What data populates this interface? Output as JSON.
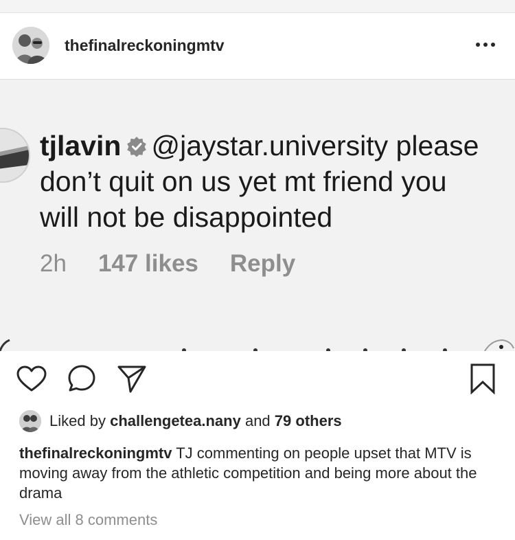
{
  "post": {
    "username": "thefinalreckoningmtv",
    "more_icon": "more-horizontal-icon"
  },
  "embedded_comment": {
    "username": "tjlavin",
    "verified_icon": "verified-badge-icon",
    "line1_text": "@jaystar.university please",
    "line2_text": "don’t quit on us yet mt friend you",
    "line3_text": "will not be disappointed",
    "time": "2h",
    "likes": "147 likes",
    "reply": "Reply"
  },
  "actions": {
    "like_icon": "heart-icon",
    "comment_icon": "comment-bubble-icon",
    "share_icon": "paper-plane-icon",
    "save_icon": "bookmark-icon"
  },
  "likes": {
    "prefix": "Liked by",
    "user": "challengetea.nany",
    "middle": "and",
    "others": "79 others"
  },
  "caption": {
    "username": "thefinalreckoningmtv",
    "text": "TJ commenting on people upset that MTV is moving away from the athletic competition and being more about the drama"
  },
  "view_comments": "View all 8 comments"
}
